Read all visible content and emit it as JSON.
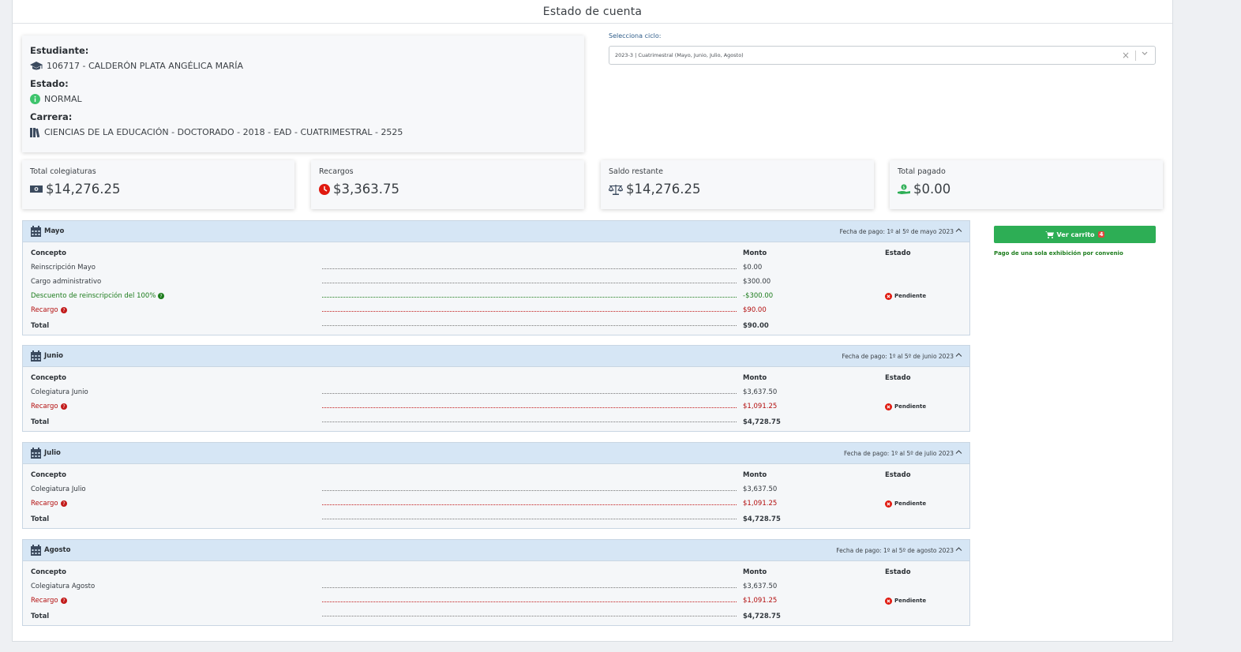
{
  "page": {
    "title": "Estado de cuenta"
  },
  "student": {
    "estudiante_label": "Estudiante:",
    "estudiante_value": "106717 - CALDERÓN PLATA ANGÉLICA MARÍA",
    "estado_label": "Estado:",
    "estado_value": "NORMAL",
    "carrera_label": "Carrera:",
    "carrera_value": "CIENCIAS DE LA EDUCACIÓN - DOCTORADO - 2018 - EAD - CUATRIMESTRAL - 2525"
  },
  "ciclo": {
    "label": "Selecciona ciclo:",
    "selected": "2023-3 | Cuatrimestral (Mayo, Junio, Julio, Agosto)"
  },
  "stats": [
    {
      "title": "Total colegiaturas",
      "value": "$14,276.25",
      "icon": "money-icon"
    },
    {
      "title": "Recargos",
      "value": "$3,363.75",
      "icon": "clock-icon"
    },
    {
      "title": "Saldo restante",
      "value": "$14,276.25",
      "icon": "scale-icon"
    },
    {
      "title": "Total pagado",
      "value": "$0.00",
      "icon": "hand-dollar-icon"
    }
  ],
  "table_headers": {
    "concepto": "Concepto",
    "monto": "Monto",
    "estado": "Estado",
    "total": "Total"
  },
  "months": [
    {
      "name": "Mayo",
      "date": "Fecha de pago: 1º al 5º de mayo 2023",
      "rows": [
        {
          "concepto": "Reinscripción Mayo",
          "monto": "$0.00",
          "estado": "",
          "kind": "normal"
        },
        {
          "concepto": "Cargo administrativo",
          "monto": "$300.00",
          "estado": "",
          "kind": "normal"
        },
        {
          "concepto": "Descuento de reinscripción del 100%",
          "monto": "-$300.00",
          "estado": "Pendiente",
          "kind": "green"
        },
        {
          "concepto": "Recargo",
          "monto": "$90.00",
          "estado": "",
          "kind": "red"
        }
      ],
      "total": "$90.00"
    },
    {
      "name": "Junio",
      "date": "Fecha de pago: 1º al 5º de junio 2023",
      "rows": [
        {
          "concepto": "Colegiatura Junio",
          "monto": "$3,637.50",
          "estado": "",
          "kind": "normal"
        },
        {
          "concepto": "Recargo",
          "monto": "$1,091.25",
          "estado": "Pendiente",
          "kind": "red"
        }
      ],
      "total": "$4,728.75"
    },
    {
      "name": "Julio",
      "date": "Fecha de pago: 1º al 5º de julio 2023",
      "rows": [
        {
          "concepto": "Colegiatura Julio",
          "monto": "$3,637.50",
          "estado": "",
          "kind": "normal"
        },
        {
          "concepto": "Recargo",
          "monto": "$1,091.25",
          "estado": "Pendiente",
          "kind": "red"
        }
      ],
      "total": "$4,728.75"
    },
    {
      "name": "Agosto",
      "date": "Fecha de pago: 1º al 5º de agosto 2023",
      "rows": [
        {
          "concepto": "Colegiatura Agosto",
          "monto": "$3,637.50",
          "estado": "",
          "kind": "normal"
        },
        {
          "concepto": "Recargo",
          "monto": "$1,091.25",
          "estado": "Pendiente",
          "kind": "red"
        }
      ],
      "total": "$4,728.75"
    }
  ],
  "cart": {
    "label": "Ver carrito",
    "count": "4",
    "note": "Pago de una sola exhibición por convenio"
  },
  "colors": {
    "header_bg": "#d6e6f5",
    "cart_green": "#2dae55",
    "recargo_red": "#b30e0e",
    "discount_green": "#1c7c1c"
  }
}
